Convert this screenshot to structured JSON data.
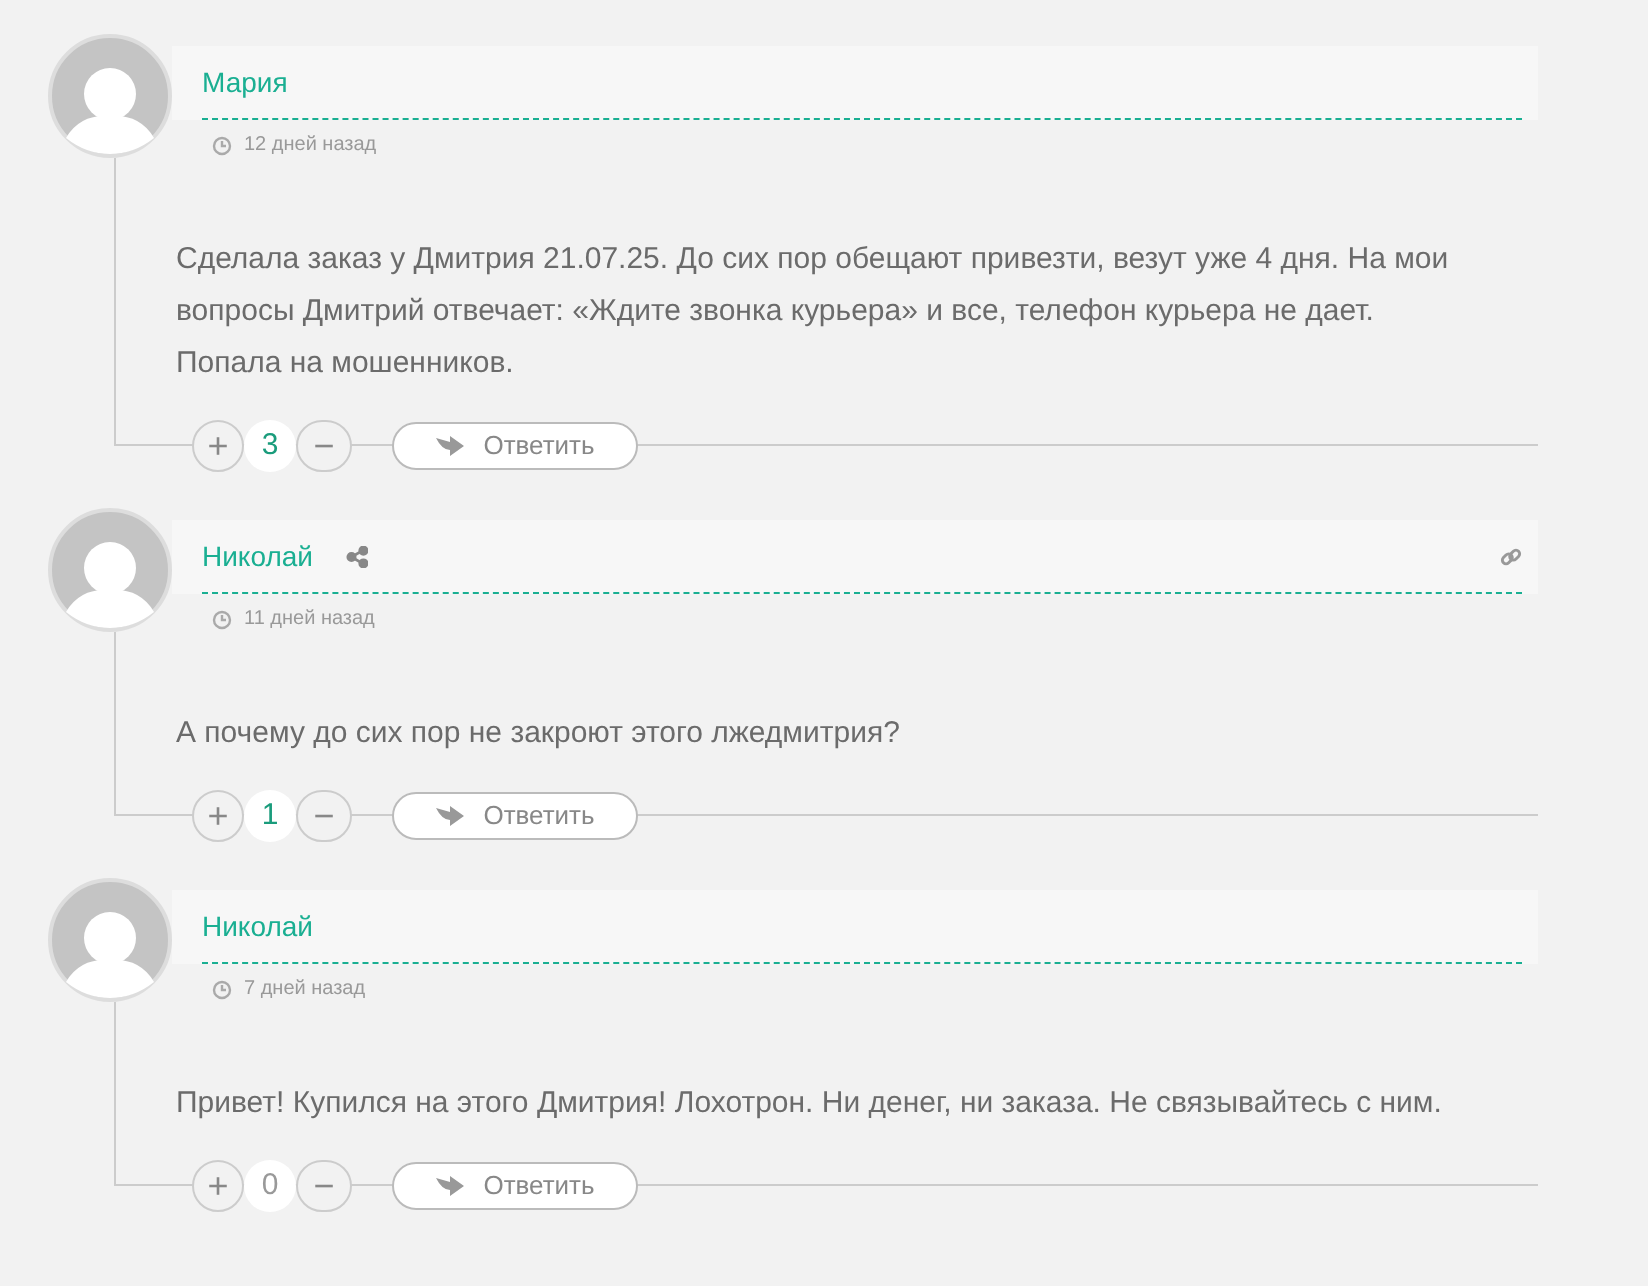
{
  "comments": [
    {
      "author": "Мария",
      "share": false,
      "link": false,
      "time": "12 дней назад",
      "text": "Сделала заказ у Дмитрия 21.07.25. До сих пор обещают привезти, везут уже 4 дня. На мои вопросы Дмитрий отвечает: «Ждите звонка курьера» и все, телефон курьера не дает. Попала на мошенников.",
      "plus": "+",
      "score": "3",
      "color": "#1a9c7c",
      "minus": "−",
      "reply": "Ответить"
    },
    {
      "author": "Николай",
      "share": true,
      "link": true,
      "time": "11 дней назад",
      "text": "А почему до сих пор не закроют этого лжедмитрия?",
      "plus": "+",
      "score": "1",
      "color": "#1a9c7c",
      "minus": "−",
      "reply": "Ответить"
    },
    {
      "author": "Николай",
      "share": false,
      "link": false,
      "time": "7 дней назад",
      "text": "Привет! Купился на этого Дмитрия! Лохотрон. Ни денег, ни заказа. Не связывайтесь с ним.",
      "plus": "+",
      "score": "0",
      "color": "#999999",
      "minus": "−",
      "reply": "Ответить"
    }
  ]
}
